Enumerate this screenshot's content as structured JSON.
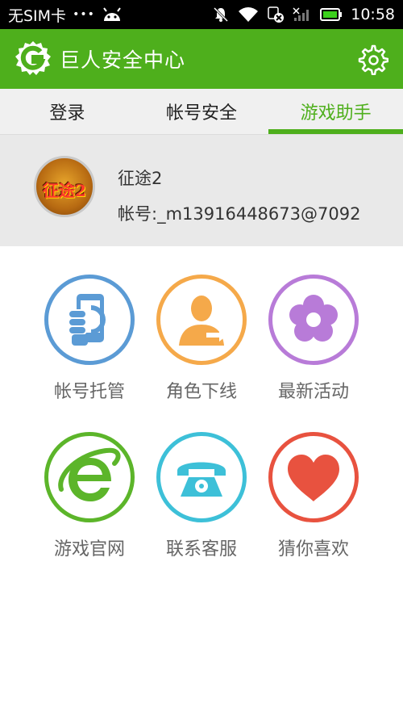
{
  "status_bar": {
    "carrier": "无SIM卡",
    "dots": "•••",
    "time": "10:58"
  },
  "app_bar": {
    "title": "巨人安全中心"
  },
  "tabs": [
    {
      "label": "登录"
    },
    {
      "label": "帐号安全"
    },
    {
      "label": "游戏助手"
    }
  ],
  "account": {
    "avatar_text": "征途2",
    "game_name": "征途2",
    "account_id": "帐号:_m13916448673@7092"
  },
  "grid": [
    {
      "label": "帐号托管",
      "icon": "phone-hand-icon",
      "color": "#5b9bd5"
    },
    {
      "label": "角色下线",
      "icon": "person-logout-icon",
      "color": "#f5a94a"
    },
    {
      "label": "最新活动",
      "icon": "flower-icon",
      "color": "#b87bd8"
    },
    {
      "label": "游戏官网",
      "icon": "ie-browser-icon",
      "color": "#5cb52a"
    },
    {
      "label": "联系客服",
      "icon": "telephone-icon",
      "color": "#3dc0d8"
    },
    {
      "label": "猜你喜欢",
      "icon": "heart-icon",
      "color": "#e8523f"
    }
  ],
  "colors": {
    "brand_green": "#4eaf1c",
    "tab_bg": "#f0f0f0",
    "card_bg": "#e9e9e9"
  }
}
